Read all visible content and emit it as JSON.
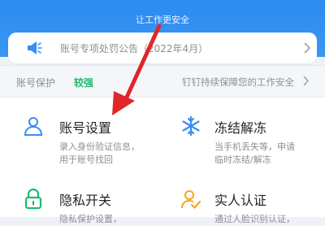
{
  "hero": {
    "slogan": "让工作更安全"
  },
  "notice": {
    "text": "账号专项处罚公告（2022年4月）",
    "icon": "megaphone-icon"
  },
  "protect": {
    "label": "账号保护",
    "level": "较强",
    "level_color": "#1dbb72",
    "right_text": "钉钉持续保障您的工作安全"
  },
  "cards": [
    {
      "title": "账号设置",
      "desc1": "录入身份验证信息，",
      "desc2": "用于账号找回",
      "icon": "person-icon"
    },
    {
      "title": "冻结解冻",
      "desc1": "当手机丢失等，申请",
      "desc2": "临时冻结/解冻",
      "icon": "snowflake-icon"
    },
    {
      "title": "隐私开关",
      "desc1": "隐私保护设置，",
      "desc2": "",
      "icon": "lock-icon"
    },
    {
      "title": "实人认证",
      "desc1": "通过人脸识别认证，",
      "desc2": "",
      "icon": "verified-person-icon"
    }
  ],
  "colors": {
    "accent": "#2d8cf0",
    "icon_blue": "#3a8df5",
    "icon_green": "#1dbb72",
    "icon_orange": "#f5a623",
    "arrow_red": "#e0262b"
  }
}
